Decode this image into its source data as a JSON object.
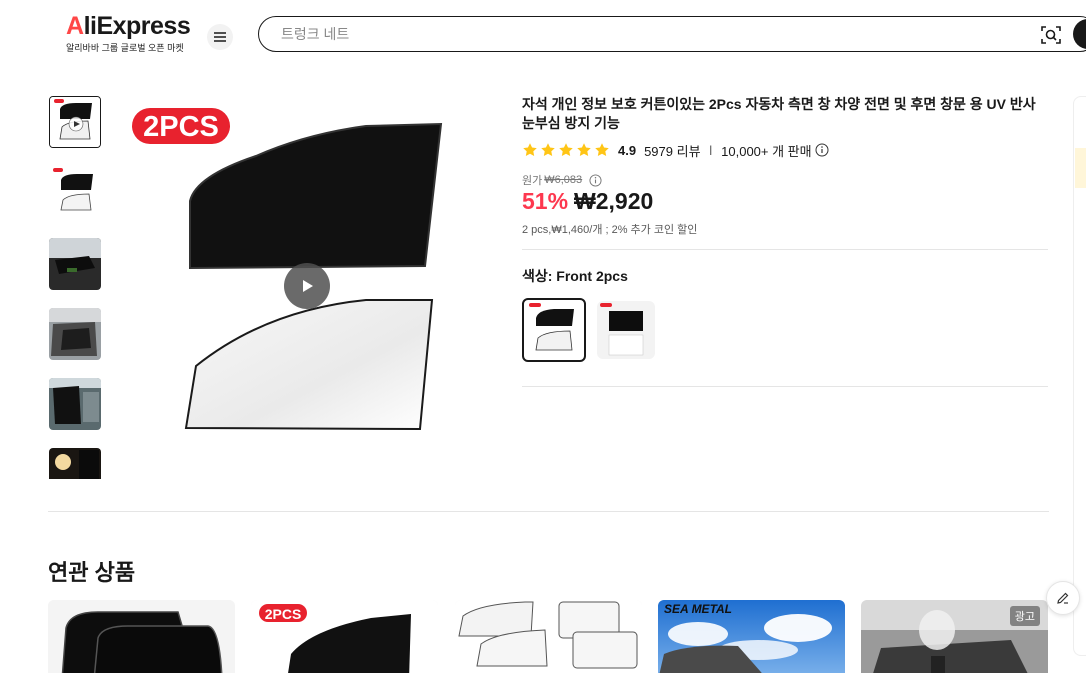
{
  "header": {
    "logo_text": "AliExpress",
    "logo_tagline": "알리바바 그룹 글로벌 오픈 마켓",
    "search_placeholder": "트렁크 네트"
  },
  "product": {
    "title": "자석 개인 정보 보호 커튼이있는 2Pcs 자동차 측면 창 차양 전면 및 후면 창문 용 UV 반사 눈부심 방지 기능",
    "rating": "4.9",
    "reviews": "5979 리뷰",
    "sold": "10,000+ 개 판매",
    "original_label": "원가",
    "original_price": "₩6,083",
    "discount": "51%",
    "price": "₩2,920",
    "unit_info": "2 pcs,₩1,460/개 ; 2% 추가 코인 할인",
    "color_label": "색상: Front 2pcs",
    "rating_stars": 5,
    "main_image_badge": "2PCS"
  },
  "related": {
    "title": "연관 상품",
    "card2_badge": "2PCS",
    "card4_brand": "SEA METAL",
    "ad_label": "광고"
  },
  "colors": {
    "accent": "#fd384f",
    "star": "#ffc516",
    "text": "#191919"
  }
}
